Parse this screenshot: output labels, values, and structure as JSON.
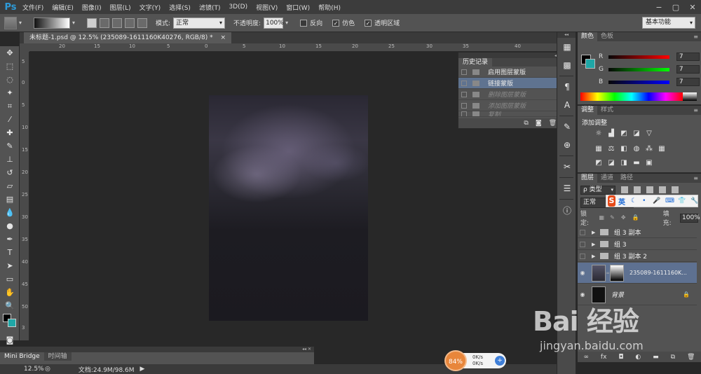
{
  "app": {
    "logo": "Ps"
  },
  "menu": [
    "文件(F)",
    "编辑(E)",
    "图像(I)",
    "图层(L)",
    "文字(Y)",
    "选择(S)",
    "滤镜(T)",
    "3D(D)",
    "视图(V)",
    "窗口(W)",
    "帮助(H)"
  ],
  "window_controls": {
    "minimize": "−",
    "restore": "▢",
    "close": "✕"
  },
  "options": {
    "mode_label": "模式:",
    "mode_value": "正常",
    "opacity_label": "不透明度:",
    "opacity_value": "100%",
    "reverse_label": "反向",
    "dither_label": "仿色",
    "transparency_label": "透明区域",
    "workspace": "基本功能"
  },
  "document": {
    "tab_title": "未标题-1.psd @ 12.5% (235089-1611160K40276, RGB/8) *",
    "close": "×",
    "ruler_h": [
      "20",
      "15",
      "10",
      "5",
      "0",
      "5",
      "10",
      "15",
      "20",
      "25",
      "30",
      "35",
      "40"
    ],
    "ruler_v": [
      "5",
      "0",
      "5",
      "10",
      "15",
      "20",
      "25",
      "30",
      "35",
      "40",
      "45",
      "50",
      "3"
    ]
  },
  "history": {
    "title": "历史记录",
    "rows": [
      {
        "label": "启用图层蒙版",
        "selected": false,
        "dim": false
      },
      {
        "label": "链接蒙版",
        "selected": true,
        "dim": false
      },
      {
        "label": "删除图层蒙版",
        "selected": false,
        "dim": true
      },
      {
        "label": "添加图层蒙版",
        "selected": false,
        "dim": true
      },
      {
        "label": "复制",
        "selected": false,
        "dim": true
      }
    ]
  },
  "color_panel": {
    "tabs": [
      "颜色",
      "色板"
    ],
    "channels": [
      {
        "label": "R",
        "value": "7"
      },
      {
        "label": "G",
        "value": "7"
      },
      {
        "label": "B",
        "value": "7"
      }
    ]
  },
  "adjust_panel": {
    "tabs": [
      "调整",
      "样式"
    ],
    "title": "添加调整"
  },
  "layers_panel": {
    "tabs": [
      "图层",
      "通道",
      "路径"
    ],
    "filter_kind": "ρ 类型",
    "blend_mode": "正常",
    "lock_label": "锁定:",
    "fill_label": "填充:",
    "fill_value": "100%",
    "layers": [
      {
        "name": "组 3 副本",
        "type": "group"
      },
      {
        "name": "组 3",
        "type": "group"
      },
      {
        "name": "组 3 副本 2",
        "type": "group"
      },
      {
        "name": "235089-1611160K...",
        "type": "image",
        "selected": true
      },
      {
        "name": "背景",
        "type": "background"
      }
    ]
  },
  "ime": {
    "logo": "S",
    "mode": "英"
  },
  "bottom_panel": {
    "tabs": [
      "Mini Bridge",
      "时间轴"
    ]
  },
  "status": {
    "zoom": "12.5%",
    "docinfo": "文档:24.9M/98.6M"
  },
  "speed_widget": {
    "percent": "84%",
    "up": "0K/s",
    "down": "0K/s"
  },
  "watermark": {
    "main": "Bai 经验",
    "sub": "jingyan.baidu.com"
  }
}
